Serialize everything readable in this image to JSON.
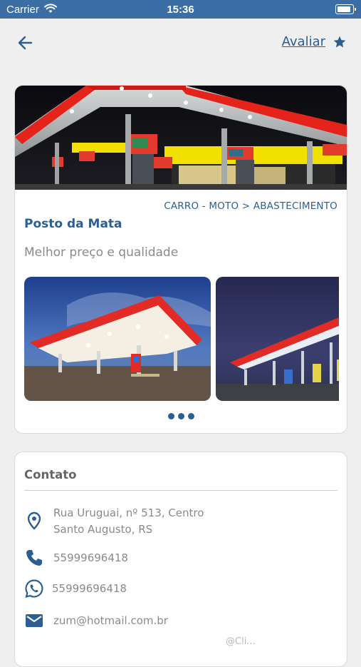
{
  "status_bar": {
    "carrier": "Carrier",
    "time": "15:36"
  },
  "header": {
    "rate_label": "Avaliar"
  },
  "place": {
    "breadcrumb": "CARRO - MOTO > ABASTECIMENTO",
    "name": "Posto da Mata",
    "tagline": "Melhor preço e qualidade",
    "gallery_page_count": 3
  },
  "contact": {
    "heading": "Contato",
    "address_line1": "Rua Uruguai, nº 513, Centro",
    "address_line2": "Santo Augusto, RS",
    "phone": "55999696418",
    "whatsapp": "55999696418",
    "email": "zum@hotmail.com.br",
    "partial_hint": "@Cli..."
  },
  "colors": {
    "primary": "#2b5f93",
    "status_bar": "#3a6ea5",
    "text_muted": "#8a8a8a"
  },
  "icons": [
    "back-arrow-icon",
    "star-icon",
    "map-pin-icon",
    "phone-icon",
    "whatsapp-icon",
    "mail-icon",
    "wifi-icon",
    "battery-icon"
  ]
}
